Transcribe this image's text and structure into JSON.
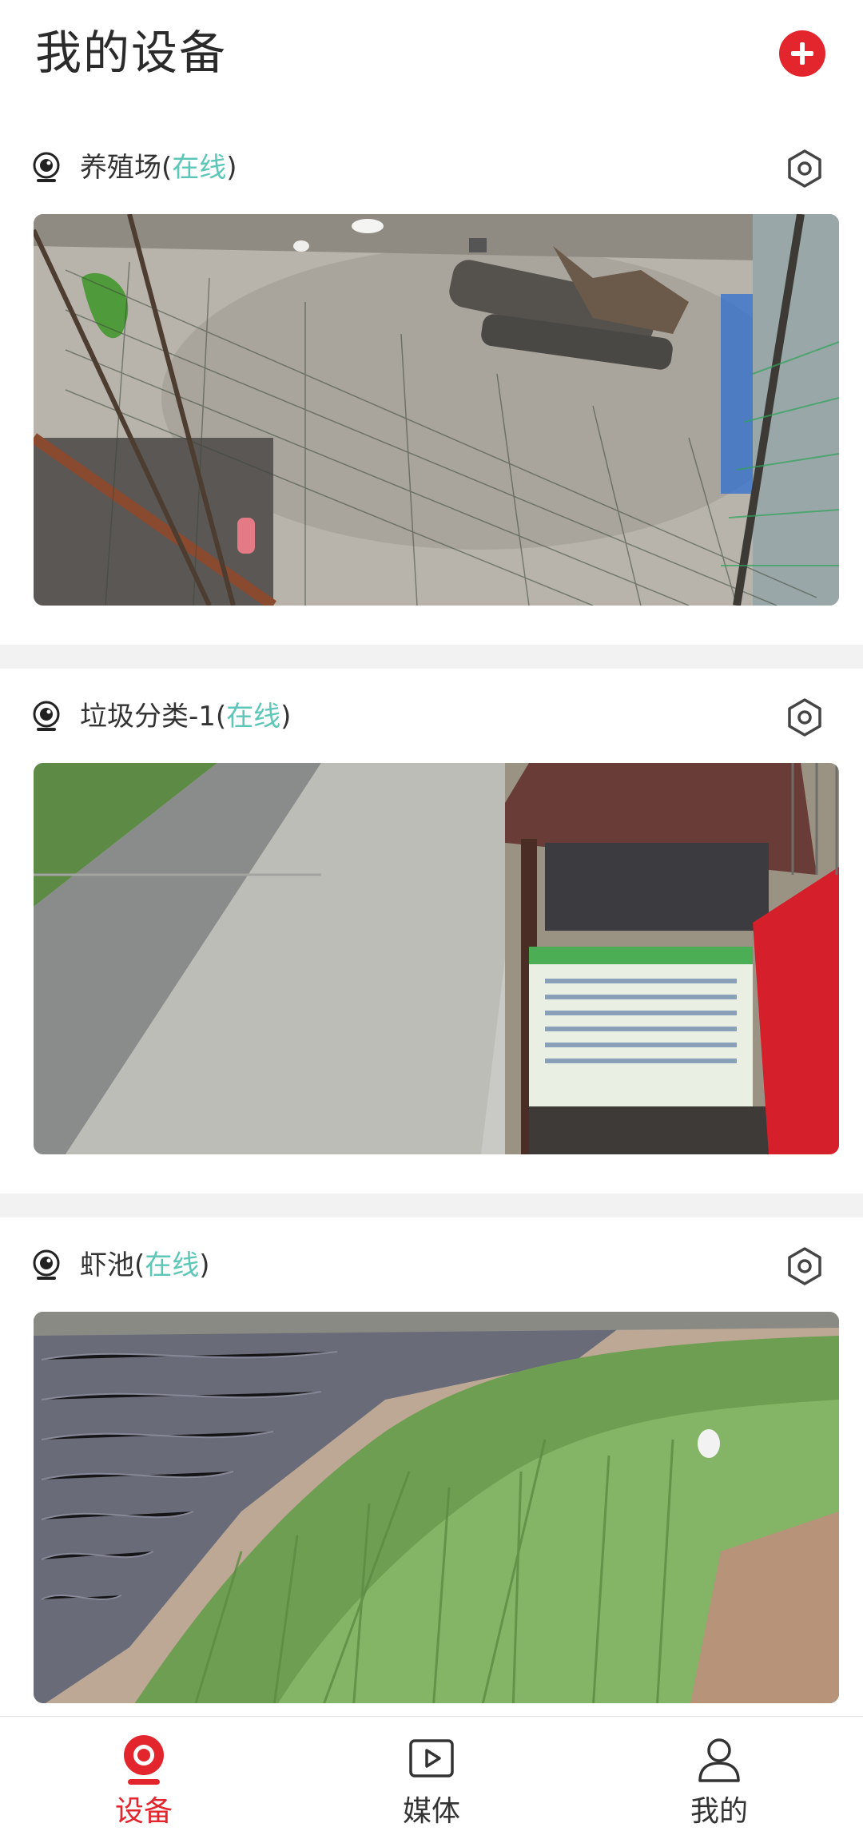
{
  "header": {
    "title": "我的设备",
    "add_icon": "plus-circle-icon"
  },
  "colors": {
    "accent": "#e3262d",
    "online": "#5cc7b8",
    "divider": "#f2f2f2",
    "text": "#333333"
  },
  "devices": [
    {
      "name": "养殖场",
      "open": "(",
      "status": "在线",
      "close": ")",
      "icon": "camera-icon",
      "settings_icon": "settings-hexagon-icon",
      "preview": "farmyard-camera-preview"
    },
    {
      "name": "垃圾分类-1",
      "open": "(",
      "status": "在线",
      "close": ")",
      "icon": "camera-icon",
      "settings_icon": "settings-hexagon-icon",
      "preview": "garbage-station-camera-preview"
    },
    {
      "name": "虾池",
      "open": "(",
      "status": "在线",
      "close": ")",
      "icon": "camera-icon",
      "settings_icon": "settings-hexagon-icon",
      "preview": "shrimp-pond-camera-preview"
    }
  ],
  "tabs": [
    {
      "label": "设备",
      "icon": "camera-icon",
      "active": true
    },
    {
      "label": "媒体",
      "icon": "video-play-icon",
      "active": false
    },
    {
      "label": "我的",
      "icon": "user-icon",
      "active": false
    }
  ]
}
